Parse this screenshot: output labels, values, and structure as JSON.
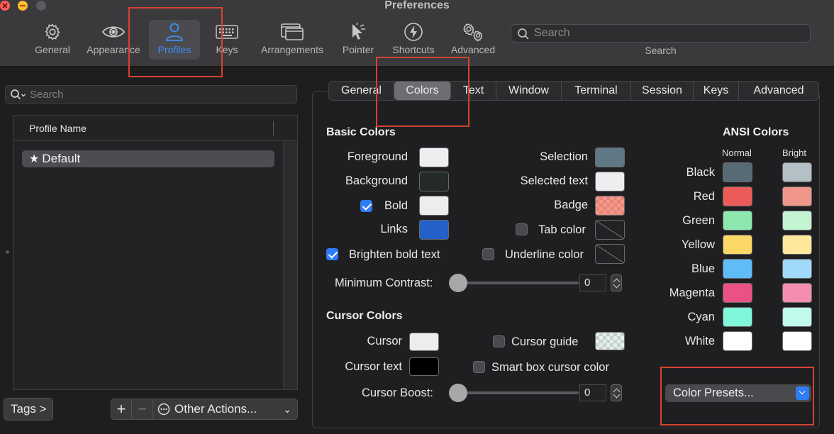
{
  "window": {
    "title": "Preferences"
  },
  "toolbar": {
    "items": [
      {
        "label": "General",
        "icon": "gear-icon"
      },
      {
        "label": "Appearance",
        "icon": "eye-icon"
      },
      {
        "label": "Profiles",
        "icon": "person-icon"
      },
      {
        "label": "Keys",
        "icon": "keyboard-icon"
      },
      {
        "label": "Arrangements",
        "icon": "windows-icon"
      },
      {
        "label": "Pointer",
        "icon": "cursor-icon"
      },
      {
        "label": "Shortcuts",
        "icon": "lightning-icon"
      },
      {
        "label": "Advanced",
        "icon": "gears-icon"
      }
    ],
    "active": "Profiles",
    "search_placeholder": "Search",
    "search_label": "Search"
  },
  "sidebar": {
    "search_placeholder": "Search",
    "column_header": "Profile Name",
    "profiles": [
      {
        "name": "Default",
        "is_default": true
      }
    ],
    "tags_button": "Tags >",
    "add_button": "+",
    "remove_button": "−",
    "other_actions": "Other Actions..."
  },
  "tabs": {
    "items": [
      "General",
      "Colors",
      "Text",
      "Window",
      "Terminal",
      "Session",
      "Keys",
      "Advanced"
    ],
    "active": "Colors"
  },
  "basic_colors": {
    "title": "Basic Colors",
    "foreground": {
      "label": "Foreground",
      "color": "#eceef0"
    },
    "background": {
      "label": "Background",
      "color": "#242a2a"
    },
    "bold": {
      "label": "Bold",
      "checked": true,
      "color": "#ededed"
    },
    "links": {
      "label": "Links",
      "color": "#2360c8"
    },
    "selection": {
      "label": "Selection",
      "color": "#607885"
    },
    "selected_text": {
      "label": "Selected text",
      "color": "#eceef0"
    },
    "badge": {
      "label": "Badge",
      "color": "#f29a8a"
    },
    "tab_color": {
      "label": "Tab color",
      "checked": false
    },
    "brighten_bold": {
      "label": "Brighten bold text",
      "checked": true
    },
    "underline_color": {
      "label": "Underline color",
      "checked": false
    },
    "min_contrast": {
      "label": "Minimum Contrast:",
      "value": "0"
    }
  },
  "cursor_colors": {
    "title": "Cursor Colors",
    "cursor": {
      "label": "Cursor",
      "color": "#ededed"
    },
    "cursor_text": {
      "label": "Cursor text",
      "color": "#000000"
    },
    "cursor_guide": {
      "label": "Cursor guide",
      "checked": false
    },
    "smart_box": {
      "label": "Smart box cursor color",
      "checked": false
    },
    "cursor_boost": {
      "label": "Cursor Boost:",
      "value": "0"
    }
  },
  "ansi": {
    "title": "ANSI Colors",
    "normal_header": "Normal",
    "bright_header": "Bright",
    "rows": [
      {
        "name": "Black",
        "normal": "#586a75",
        "bright": "#b3c0c6"
      },
      {
        "name": "Red",
        "normal": "#ec5b57",
        "bright": "#f1968b"
      },
      {
        "name": "Green",
        "normal": "#8de8b0",
        "bright": "#c4f5d2"
      },
      {
        "name": "Yellow",
        "normal": "#fbd765",
        "bright": "#fde89c"
      },
      {
        "name": "Blue",
        "normal": "#5fbcf6",
        "bright": "#a0d9fa"
      },
      {
        "name": "Magenta",
        "normal": "#ec5185",
        "bright": "#f58db0"
      },
      {
        "name": "Cyan",
        "normal": "#80f7db",
        "bright": "#bffaea"
      },
      {
        "name": "White",
        "normal": "#ffffff",
        "bright": "#ffffff"
      }
    ],
    "presets_button": "Color Presets..."
  },
  "annotation_color": "#d64232"
}
